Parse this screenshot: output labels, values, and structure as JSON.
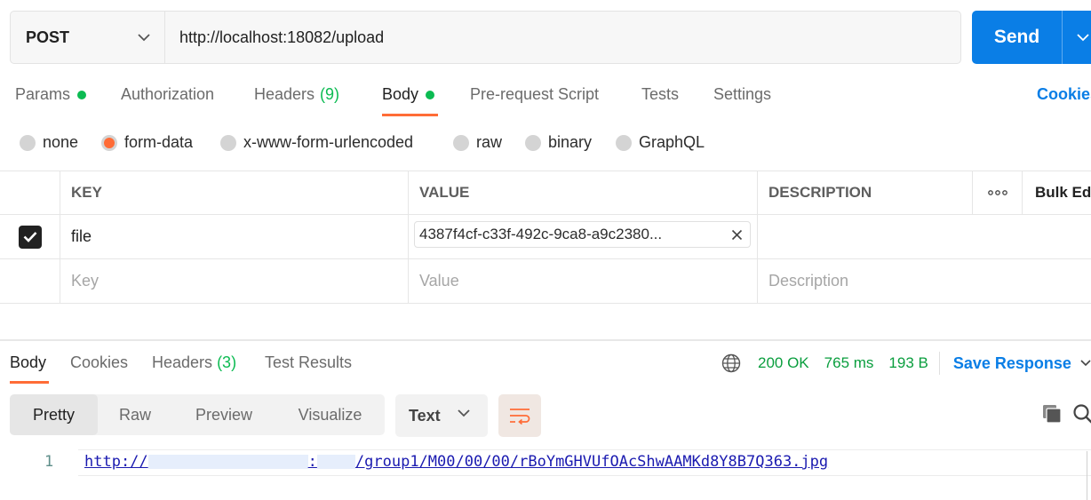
{
  "request": {
    "method": "POST",
    "url": "http://localhost:18082/upload",
    "send_label": "Send"
  },
  "request_tabs": {
    "params": "Params",
    "authorization": "Authorization",
    "headers": "Headers",
    "headers_count": "(9)",
    "body": "Body",
    "pre_request": "Pre-request Script",
    "tests": "Tests",
    "settings": "Settings",
    "cookies": "Cookies"
  },
  "body_types": {
    "none": "none",
    "form_data": "form-data",
    "urlencoded": "x-www-form-urlencoded",
    "raw": "raw",
    "binary": "binary",
    "graphql": "GraphQL",
    "selected": "form-data"
  },
  "params_table": {
    "headers": {
      "key": "KEY",
      "value": "VALUE",
      "description": "DESCRIPTION",
      "bulk_edit": "Bulk Edit"
    },
    "rows": [
      {
        "checked": true,
        "key": "file",
        "value": "4387f4cf-c33f-492c-9ca8-a9c2380...",
        "description": ""
      }
    ],
    "placeholders": {
      "key": "Key",
      "value": "Value",
      "description": "Description"
    }
  },
  "response": {
    "tabs": {
      "body": "Body",
      "cookies": "Cookies",
      "headers": "Headers",
      "headers_count": "(3)",
      "test_results": "Test Results"
    },
    "status": "200 OK",
    "time": "765 ms",
    "size": "193 B",
    "save_label": "Save Response",
    "views": {
      "pretty": "Pretty",
      "raw": "Raw",
      "preview": "Preview",
      "visualize": "Visualize"
    },
    "format": "Text",
    "lines": [
      {
        "number": "1",
        "prefix": "http://",
        "sep": ":",
        "suffix": "/group1/M00/00/00/rBoYmGHVUfOAcShwAAMKd8Y8B7Q363.jpg"
      }
    ]
  },
  "colors": {
    "accent_orange": "#ff6c37",
    "send_blue": "#0a7ee6",
    "status_green": "#0a9e3e"
  }
}
